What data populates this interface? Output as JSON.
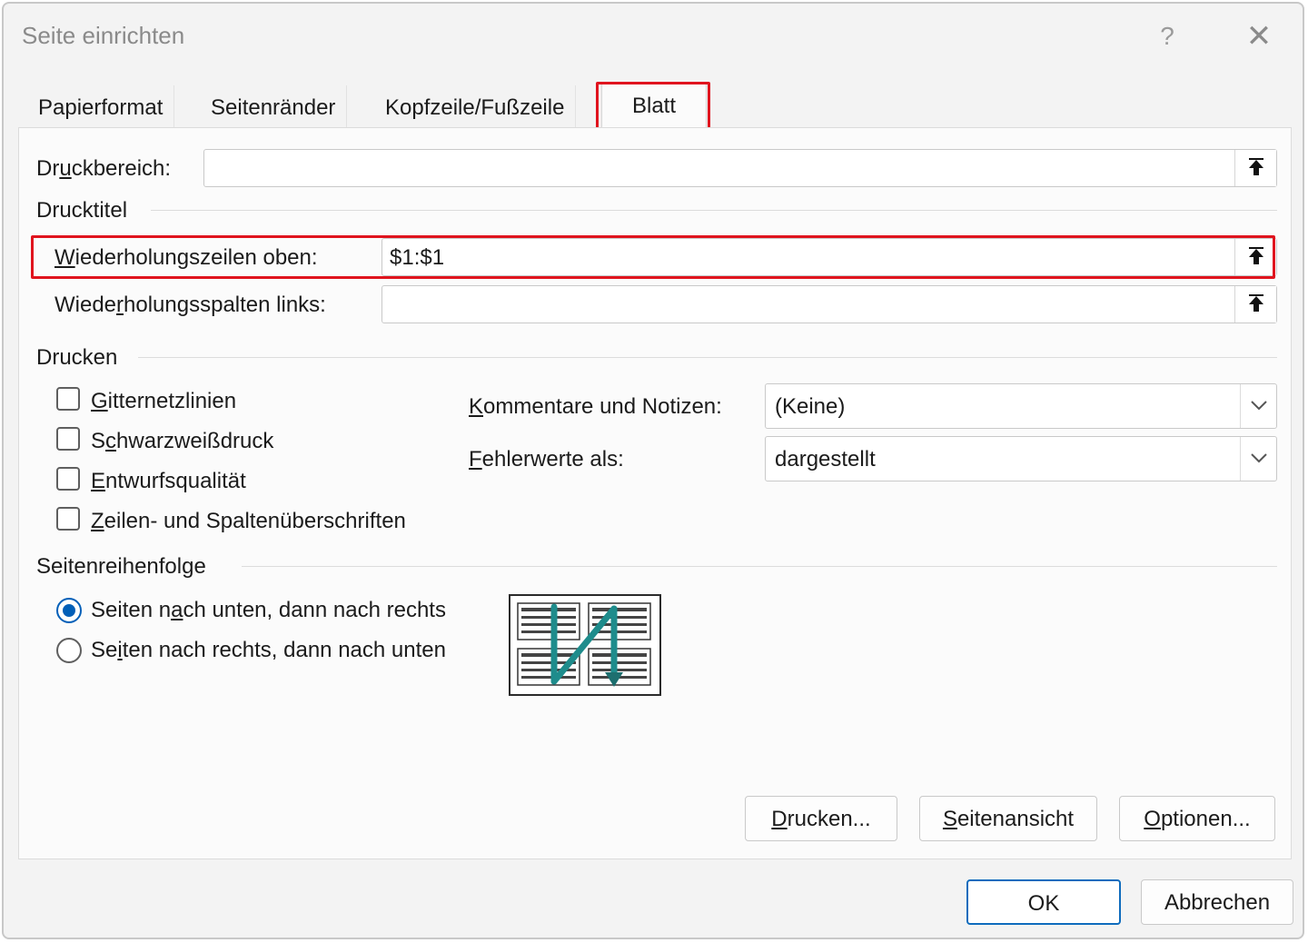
{
  "window": {
    "title": "Seite einrichten",
    "help_symbol": "?",
    "close_symbol": "✕"
  },
  "tabs": [
    {
      "label": "Papierformat",
      "active": false
    },
    {
      "label": "Seitenränder",
      "active": false
    },
    {
      "label": "Kopfzeile/Fußzeile",
      "active": false
    },
    {
      "label": "Blatt",
      "active": true
    }
  ],
  "print_area": {
    "label_pre": "Dr",
    "label_accel": "u",
    "label_post": "ckbereich:",
    "value": ""
  },
  "print_titles": {
    "title": "Drucktitel",
    "rows_label_accel": "W",
    "rows_label_post": "iederholungszeilen oben:",
    "rows_value": "$1:$1",
    "cols_label_pre": "Wiede",
    "cols_label_accel": "r",
    "cols_label_post": "holungsspalten links:",
    "cols_value": ""
  },
  "print_section": {
    "title": "Drucken",
    "checkboxes": [
      {
        "accel": "G",
        "rest": "itternetzlinien",
        "checked": false
      },
      {
        "pre": "S",
        "accel": "c",
        "rest": "hwarzweißdruck",
        "checked": false
      },
      {
        "accel": "E",
        "rest": "ntwurfsqualität",
        "checked": false
      },
      {
        "accel": "Z",
        "rest": "eilen- und Spaltenüberschriften",
        "checked": false
      }
    ],
    "comments_label_accel": "K",
    "comments_label_post": "ommentare und Notizen:",
    "comments_value": "(Keine)",
    "errors_label_accel": "F",
    "errors_label_post": "ehlerwerte als:",
    "errors_value": "dargestellt"
  },
  "page_order": {
    "title": "Seitenreihenfolge",
    "options": [
      {
        "pre": "Seiten n",
        "accel": "a",
        "post": "ch unten, dann nach rechts",
        "checked": true
      },
      {
        "pre": "Se",
        "accel": "i",
        "post": "ten nach rechts, dann nach unten",
        "checked": false
      }
    ]
  },
  "buttons": {
    "print_accel": "D",
    "print_rest": "rucken...",
    "preview_accel": "S",
    "preview_rest": "eitenansicht",
    "options_accel": "O",
    "options_rest": "ptionen...",
    "ok": "OK",
    "cancel": "Abbrechen"
  },
  "colors": {
    "highlight": "#e0141e",
    "accent": "#005fb8",
    "arrow_teal": "#1e8c8c"
  }
}
